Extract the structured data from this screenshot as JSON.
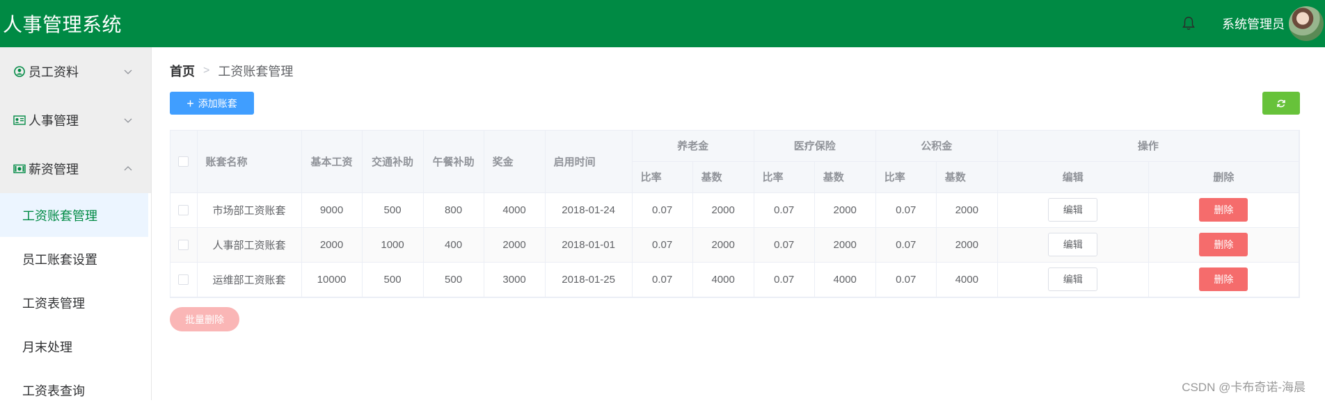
{
  "header": {
    "title": "人事管理系统",
    "user_name": "系统管理员"
  },
  "sidebar": {
    "groups": [
      {
        "label": "员工资料",
        "icon": "user-circle-icon",
        "expanded": false
      },
      {
        "label": "人事管理",
        "icon": "id-card-icon",
        "expanded": false
      },
      {
        "label": "薪资管理",
        "icon": "money-icon",
        "expanded": true
      }
    ],
    "submenu": [
      "工资账套管理",
      "员工账套设置",
      "工资表管理",
      "月末处理",
      "工资表查询"
    ],
    "active_submenu": "工资账套管理"
  },
  "breadcrumb": {
    "home": "首页",
    "separator": ">",
    "current": "工资账套管理"
  },
  "toolbar": {
    "add_label": "添加账套",
    "refresh_icon": "refresh-icon"
  },
  "table": {
    "headers": {
      "name": "账套名称",
      "base_salary": "基本工资",
      "traffic": "交通补助",
      "lunch": "午餐补助",
      "bonus": "奖金",
      "start_date": "启用时间",
      "pension": "养老金",
      "medical": "医疗保险",
      "housing": "公积金",
      "ops": "操作",
      "ratio": "比率",
      "base": "基数",
      "edit": "编辑",
      "delete": "删除"
    },
    "rows": [
      {
        "name": "市场部工资账套",
        "base_salary": "9000",
        "traffic": "500",
        "lunch": "800",
        "bonus": "4000",
        "start_date": "2018-01-24",
        "pension_ratio": "0.07",
        "pension_base": "2000",
        "medical_ratio": "0.07",
        "medical_base": "2000",
        "housing_ratio": "0.07",
        "housing_base": "2000"
      },
      {
        "name": "人事部工资账套",
        "base_salary": "2000",
        "traffic": "1000",
        "lunch": "400",
        "bonus": "2000",
        "start_date": "2018-01-01",
        "pension_ratio": "0.07",
        "pension_base": "2000",
        "medical_ratio": "0.07",
        "medical_base": "2000",
        "housing_ratio": "0.07",
        "housing_base": "2000"
      },
      {
        "name": "运维部工资账套",
        "base_salary": "10000",
        "traffic": "500",
        "lunch": "500",
        "bonus": "3000",
        "start_date": "2018-01-25",
        "pension_ratio": "0.07",
        "pension_base": "4000",
        "medical_ratio": "0.07",
        "medical_base": "4000",
        "housing_ratio": "0.07",
        "housing_base": "4000"
      }
    ],
    "edit_label": "编辑",
    "delete_label": "删除"
  },
  "batch_delete_label": "批量删除",
  "watermark": "CSDN @卡布奇诺-海晨",
  "colors": {
    "header": "#008a44",
    "primary": "#409eff",
    "success": "#67c23a",
    "danger": "#f56c6c"
  }
}
